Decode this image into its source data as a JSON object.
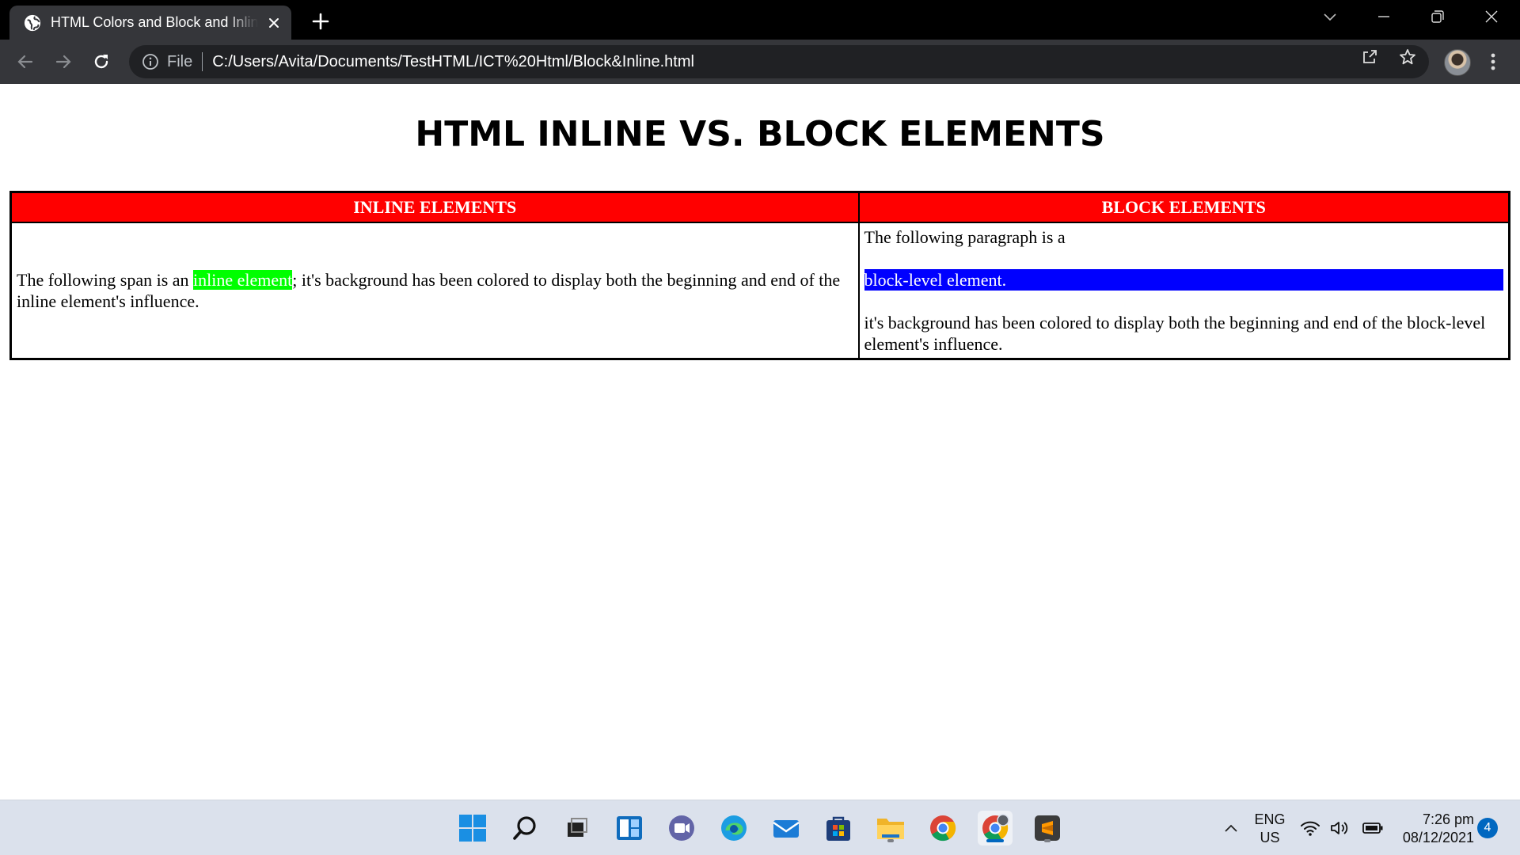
{
  "browser": {
    "tab_title": "HTML Colors and Block and Inline Elements",
    "omnibox": {
      "scheme_label": "File",
      "url": "C:/Users/Avita/Documents/TestHTML/ICT%20Html/Block&Inline.html"
    },
    "icons": [
      "globe-icon",
      "close-icon",
      "plus-icon",
      "chevron-down-icon",
      "minimize-icon",
      "restore-icon",
      "back-icon",
      "forward-icon",
      "reload-icon",
      "info-icon",
      "share-icon",
      "star-icon",
      "more-vert-icon"
    ]
  },
  "page": {
    "heading": "HTML INLINE VS. BLOCK ELEMENTS",
    "table": {
      "headers": [
        "INLINE ELEMENTS",
        "BLOCK ELEMENTS"
      ],
      "header_bg": "#ff0000",
      "inline_cell": {
        "before": "The following span is an ",
        "highlight": "inline element",
        "after": "; it's background has been colored to display both the beginning and end of the inline element's influence.",
        "highlight_color": "#00ff00"
      },
      "block_cell": {
        "intro": "The following paragraph is a",
        "highlight": "block-level element.",
        "after": "it's background has been colored to display both the beginning and end of the block-level element's influence.",
        "highlight_color": "#0000ff"
      }
    }
  },
  "taskbar": {
    "apps": [
      "windows-start",
      "search",
      "task-view",
      "widgets",
      "teams-chat",
      "edge",
      "mail",
      "store",
      "file-explorer",
      "chrome",
      "chrome-profile",
      "sublime-text"
    ],
    "language_line1": "ENG",
    "language_line2": "US",
    "time": "7:26 pm",
    "date": "08/12/2021",
    "notification_count": "4"
  }
}
